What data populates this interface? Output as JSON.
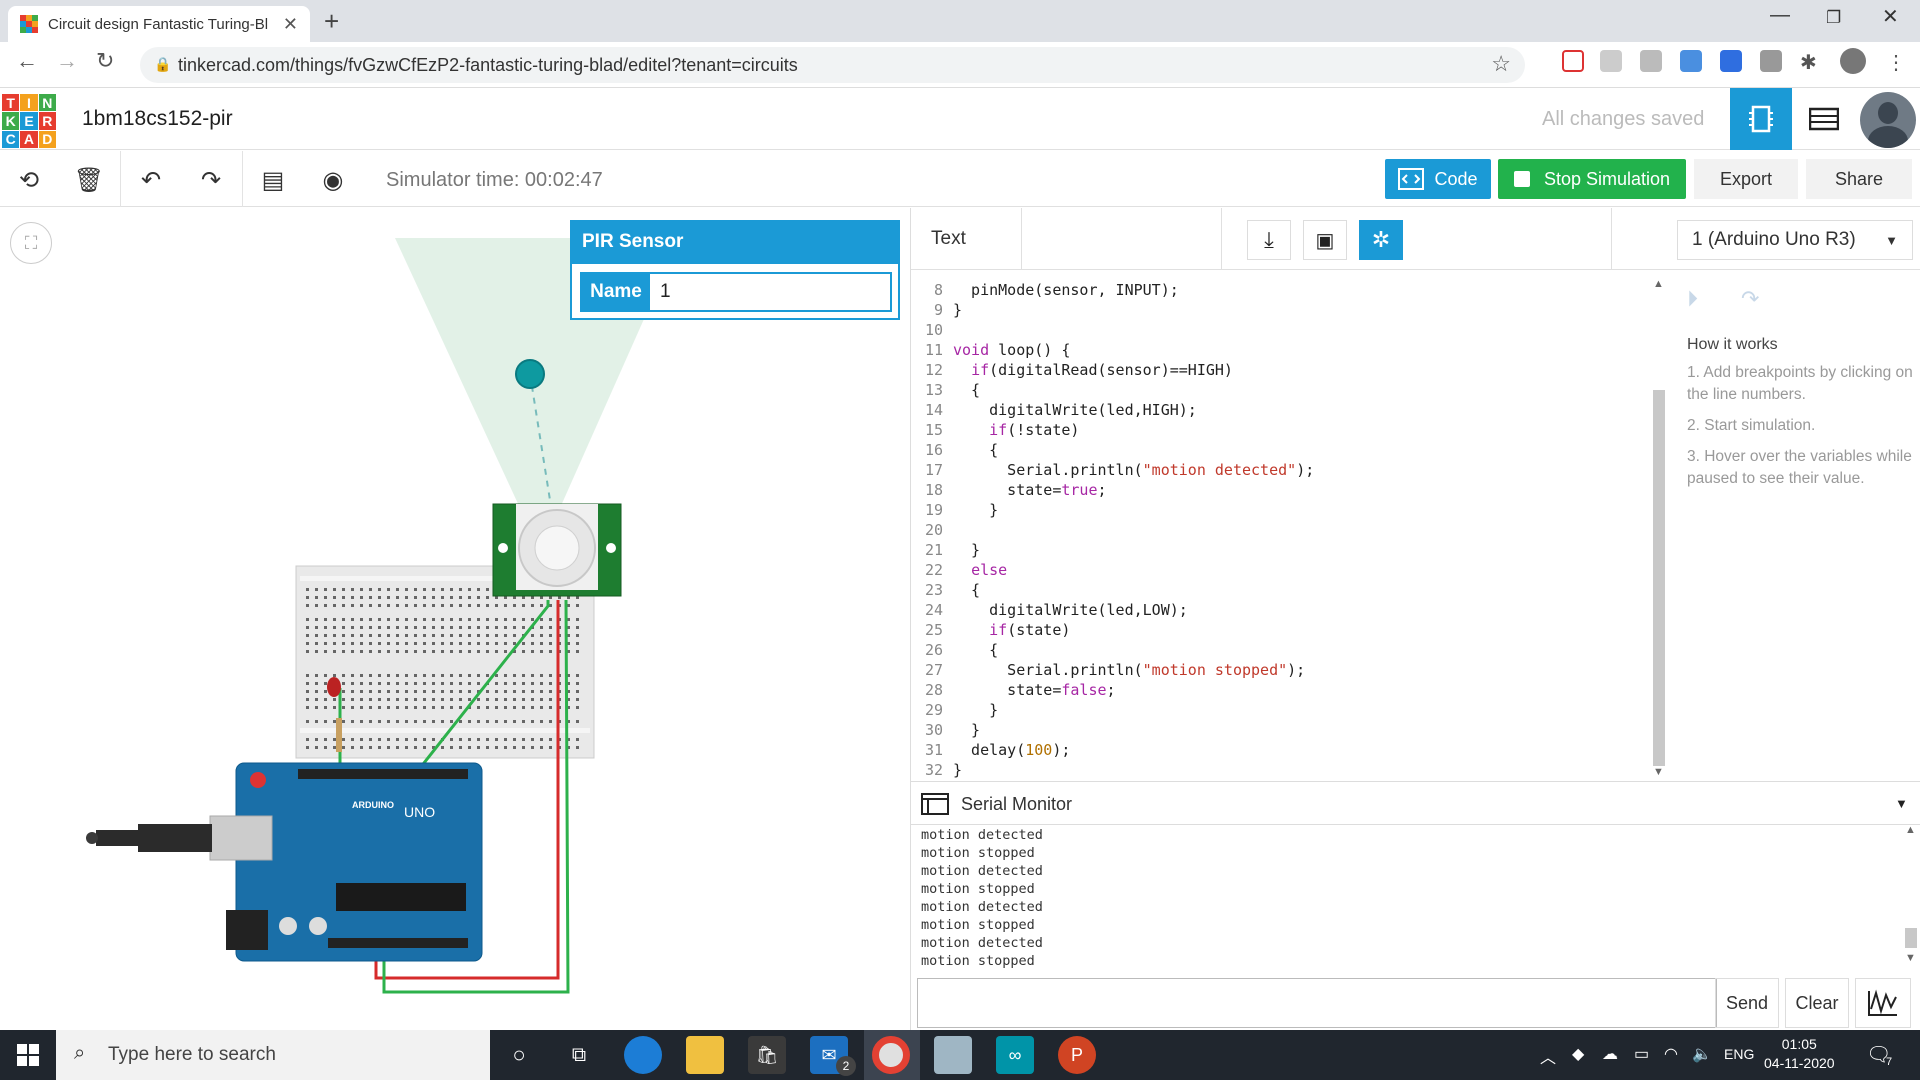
{
  "browser": {
    "tab_title": "Circuit design Fantastic Turing-Bl",
    "url": "tinkercad.com/things/fvGzwCfEzP2-fantastic-turing-blad/editel?tenant=circuits"
  },
  "header": {
    "logo_letters": [
      "T",
      "I",
      "N",
      "K",
      "E",
      "R",
      "C",
      "A",
      "D"
    ],
    "project_name": "1bm18cs152-pir",
    "save_status": "All changes saved"
  },
  "toolbar": {
    "simulator_time": "Simulator time: 00:02:47",
    "code_label": "Code",
    "stop_label": "Stop Simulation",
    "export_label": "Export",
    "share_label": "Share"
  },
  "inspector": {
    "title": "PIR Sensor",
    "name_label": "Name",
    "name_value": "1"
  },
  "code_panel": {
    "mode_label": "Text",
    "device": "1 (Arduino Uno R3)",
    "lines": [
      {
        "n": "8",
        "t": "  pinMode(sensor, INPUT);"
      },
      {
        "n": "9",
        "t": "}"
      },
      {
        "n": "10",
        "t": ""
      },
      {
        "n": "11",
        "t": "void loop() {"
      },
      {
        "n": "12",
        "t": "  if(digitalRead(sensor)==HIGH)"
      },
      {
        "n": "13",
        "t": "  {"
      },
      {
        "n": "14",
        "t": "    digitalWrite(led,HIGH);"
      },
      {
        "n": "15",
        "t": "    if(!state)"
      },
      {
        "n": "16",
        "t": "    {"
      },
      {
        "n": "17",
        "t": "      Serial.println(\"motion detected\");"
      },
      {
        "n": "18",
        "t": "      state=true;"
      },
      {
        "n": "19",
        "t": "    }"
      },
      {
        "n": "20",
        "t": ""
      },
      {
        "n": "21",
        "t": "  }"
      },
      {
        "n": "22",
        "t": "  else"
      },
      {
        "n": "23",
        "t": "  {"
      },
      {
        "n": "24",
        "t": "    digitalWrite(led,LOW);"
      },
      {
        "n": "25",
        "t": "    if(state)"
      },
      {
        "n": "26",
        "t": "    {"
      },
      {
        "n": "27",
        "t": "      Serial.println(\"motion stopped\");"
      },
      {
        "n": "28",
        "t": "      state=false;"
      },
      {
        "n": "29",
        "t": "    }"
      },
      {
        "n": "30",
        "t": "  }"
      },
      {
        "n": "31",
        "t": "  delay(100);"
      },
      {
        "n": "32",
        "t": "}"
      }
    ],
    "how_it_works": {
      "title": "How it works",
      "steps": [
        "1. Add breakpoints by clicking on the line numbers.",
        "2. Start simulation.",
        "3. Hover over the variables while paused to see their value."
      ]
    }
  },
  "serial_monitor": {
    "title": "Serial Monitor",
    "output": [
      "motion detected",
      "motion stopped",
      "motion detected",
      "motion stopped",
      "motion detected",
      "motion stopped",
      "motion detected",
      "motion stopped"
    ],
    "input_value": "",
    "send_label": "Send",
    "clear_label": "Clear"
  },
  "taskbar": {
    "search_placeholder": "Type here to search",
    "mail_badge": "2",
    "language": "ENG",
    "time": "01:05",
    "date": "04-11-2020",
    "notifications": "7"
  },
  "colors": {
    "accent": "#1b9ad6",
    "stop_green": "#22b24c"
  }
}
